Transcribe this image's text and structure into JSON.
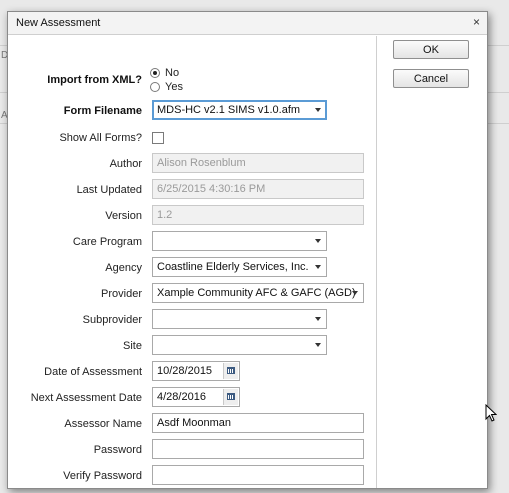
{
  "dialog": {
    "title": "New Assessment",
    "close_glyph": "×"
  },
  "form": {
    "import_xml": {
      "label": "Import from XML?",
      "options": [
        "No",
        "Yes"
      ],
      "selected": "No"
    },
    "form_filename": {
      "label": "Form Filename",
      "value": "MDS-HC v2.1 SIMS v1.0.afm"
    },
    "show_all_forms": {
      "label": "Show All Forms?",
      "checked": false
    },
    "author": {
      "label": "Author",
      "value": "Alison Rosenblum"
    },
    "last_updated": {
      "label": "Last Updated",
      "value": "6/25/2015 4:30:16 PM"
    },
    "version": {
      "label": "Version",
      "value": "1.2"
    },
    "care_program": {
      "label": "Care Program",
      "value": ""
    },
    "agency": {
      "label": "Agency",
      "value": "Coastline Elderly Services, Inc."
    },
    "provider": {
      "label": "Provider",
      "value": "Xample Community AFC & GAFC (AGD)"
    },
    "subprovider": {
      "label": "Subprovider",
      "value": ""
    },
    "site": {
      "label": "Site",
      "value": ""
    },
    "date_of_assessment": {
      "label": "Date of Assessment",
      "value": "10/28/2015"
    },
    "next_assessment_date": {
      "label": "Next Assessment Date",
      "value": "4/28/2016"
    },
    "assessor_name": {
      "label": "Assessor Name",
      "value": "Asdf Moonman"
    },
    "password": {
      "label": "Password",
      "value": ""
    },
    "verify_password": {
      "label": "Verify Password",
      "value": ""
    }
  },
  "buttons": {
    "ok": "OK",
    "cancel": "Cancel"
  },
  "background": {
    "marks": [
      "D",
      "A"
    ]
  },
  "icons": {
    "close": "close-icon",
    "dropdown": "chevron-down-icon",
    "calendar": "calendar-icon",
    "cursor": "mouse-pointer-icon"
  },
  "colors": {
    "focus_border": "#5b9bd5",
    "disabled_text": "#9a9a9a"
  }
}
